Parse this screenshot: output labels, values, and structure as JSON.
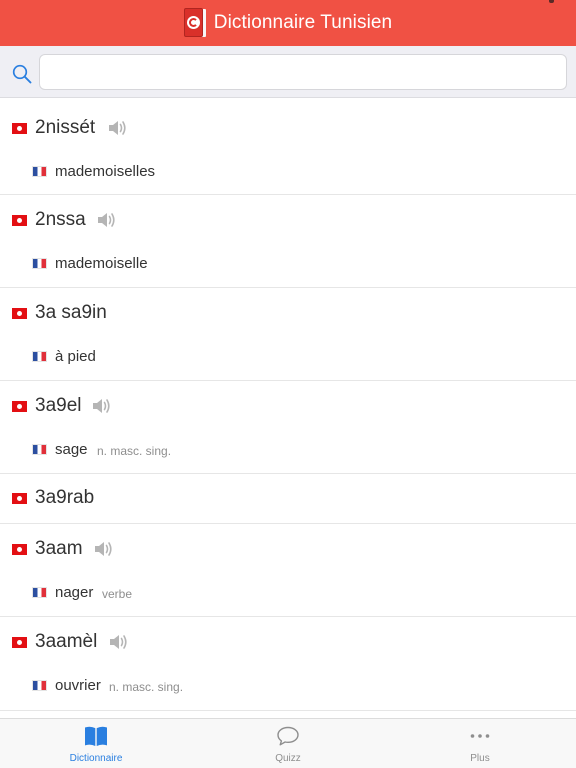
{
  "header": {
    "title": "Dictionnaire Tunisien"
  },
  "search": {
    "value": "",
    "placeholder": ""
  },
  "entries": [
    {
      "word": "2nissét",
      "audio": true,
      "translation": "mademoiselles",
      "pos": ""
    },
    {
      "word": "2nssa",
      "audio": true,
      "translation": "mademoiselle",
      "pos": ""
    },
    {
      "word": "3a sa9in",
      "audio": false,
      "translation": "à pied",
      "pos": ""
    },
    {
      "word": "3a9el",
      "audio": true,
      "translation": "sage",
      "pos": "n. masc. sing."
    },
    {
      "word": "3a9rab",
      "audio": false,
      "translation": "",
      "pos": ""
    },
    {
      "word": "3aam",
      "audio": true,
      "translation": "nager",
      "pos": "verbe"
    },
    {
      "word": "3aamèl",
      "audio": true,
      "translation": "ouvrier",
      "pos": "n. masc. sing."
    }
  ],
  "tabs": [
    {
      "label": "Dictionnaire",
      "icon": "book-icon",
      "active": true
    },
    {
      "label": "Quizz",
      "icon": "speech-bubble-icon",
      "active": false
    },
    {
      "label": "Plus",
      "icon": "more-icon",
      "active": false
    }
  ],
  "colors": {
    "header": "#f05144",
    "accent": "#2a7fe0",
    "tunisia_flag": "#e30f13",
    "inactive": "#8e8e8e"
  }
}
